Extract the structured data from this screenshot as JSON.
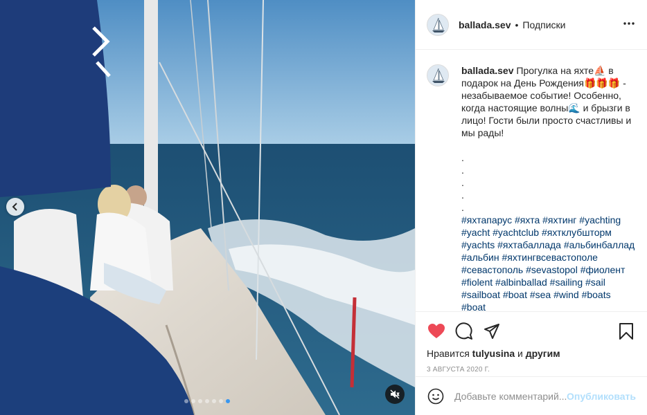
{
  "post": {
    "username": "ballada.sev",
    "separator": "•",
    "follow_label": "Подписки",
    "more_icon": "more-horizontal-icon"
  },
  "caption": {
    "username": "ballada.sev",
    "text": "Прогулка на яхте⛵ в подарок на День Рождения🎁🎁🎁 - незабываемое событие! Особенно, когда настоящие волны🌊 и брызги в лицо! Гости были просто счастливы и мы рады!",
    "dots": [
      ".",
      ".",
      ".",
      ".",
      "."
    ],
    "hashtags": "#яхтапарус #яхта #яхтинг #yachting #yacht #yachtclub #яхтклубшторм #yachts #яхтабаллада #альбинбаллад #альбин #яхтингвсевастополе #севастополь #sevastopol #фиолент #fiolent #albinballad #sailing #sail #sailboat #boat #sea #wind #boats #boat"
  },
  "likes": {
    "prefix": "Нравится",
    "user": "tulyusina",
    "middle": "и",
    "suffix": "другим"
  },
  "date": "3 августа 2020 г.",
  "comment_box": {
    "placeholder": "Добавьте комментарий...",
    "publish_label": "Опубликовать"
  },
  "carousel": {
    "count": 7,
    "active_index": 6
  },
  "colors": {
    "like_heart": "#ed4956",
    "link_blue": "#00376b",
    "publish_disabled": "#b2dffc",
    "active_dot": "#3897f0"
  },
  "icons": [
    "heart-icon",
    "comment-icon",
    "share-icon",
    "bookmark-icon",
    "emoji-icon",
    "mute-icon",
    "chevron-left-icon"
  ]
}
